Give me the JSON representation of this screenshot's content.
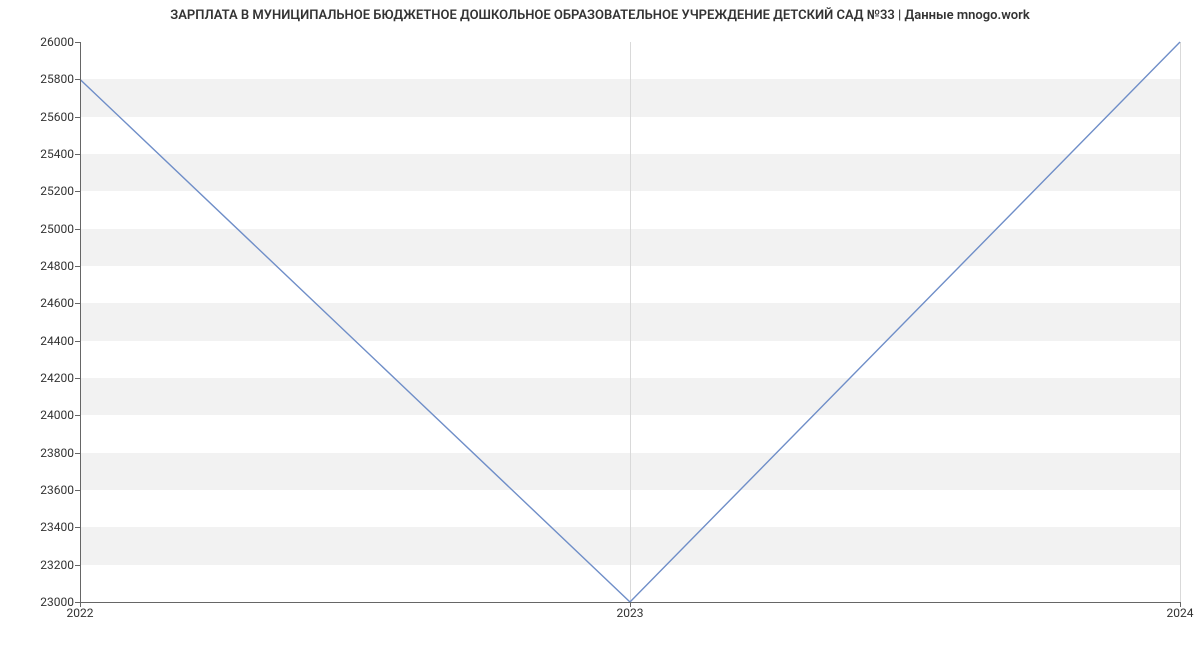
{
  "chart_data": {
    "type": "line",
    "title": "ЗАРПЛАТА В МУНИЦИПАЛЬНОЕ БЮДЖЕТНОЕ ДОШКОЛЬНОЕ ОБРАЗОВАТЕЛЬНОЕ УЧРЕЖДЕНИЕ ДЕТСКИЙ САД №33 | Данные mnogo.work",
    "x": [
      2022,
      2023,
      2024
    ],
    "categories": [
      "2022",
      "2023",
      "2024"
    ],
    "values": [
      25800,
      23000,
      26000
    ],
    "xlabel": "",
    "ylabel": "",
    "ylim": [
      23000,
      26000
    ],
    "xlim": [
      2022,
      2024
    ],
    "y_ticks": [
      23000,
      23200,
      23400,
      23600,
      23800,
      24000,
      24200,
      24400,
      24600,
      24800,
      25000,
      25200,
      25400,
      25600,
      25800,
      26000
    ],
    "x_ticks": [
      2022,
      2023,
      2024
    ],
    "grid": true
  },
  "colors": {
    "line": "#6f8ec8",
    "band": "#f2f2f2"
  }
}
